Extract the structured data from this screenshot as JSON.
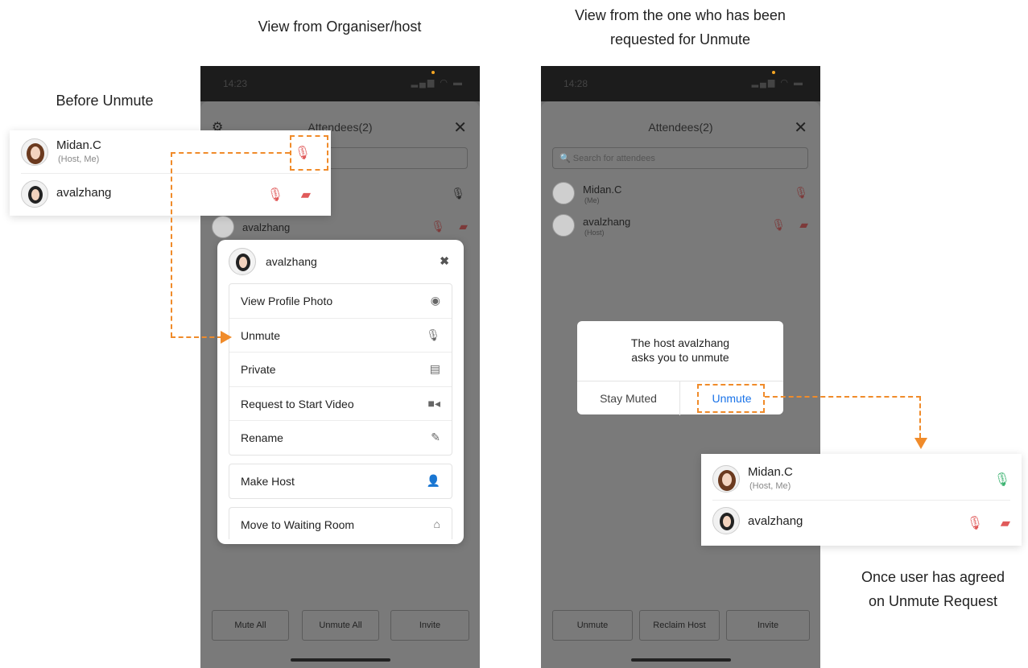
{
  "captions": {
    "organiser": "View from Organiser/host",
    "requested_line1": "View from the one who has been",
    "requested_line2": "requested for Unmute",
    "before": "Before Unmute",
    "after_line1": "Once user has agreed",
    "after_line2": "on Unmute Request"
  },
  "phone_left": {
    "time": "14:23",
    "title": "Attendees(2)",
    "rows": [
      {
        "name": "avalzhang"
      }
    ],
    "bottom_buttons": [
      "Mute All",
      "Unmute All",
      "Invite"
    ]
  },
  "phone_right": {
    "time": "14:28",
    "title": "Attendees(2)",
    "search_placeholder": "Search for attendees",
    "rows": [
      {
        "name": "Midan.C",
        "sub": "(Me)"
      },
      {
        "name": "avalzhang",
        "sub": "(Host)"
      }
    ],
    "bottom_buttons": [
      "Unmute",
      "Reclaim Host",
      "Invite"
    ]
  },
  "before_card": {
    "rows": [
      {
        "name": "Midan.C",
        "sub": "(Host, Me)"
      },
      {
        "name": "avalzhang",
        "sub": ""
      }
    ]
  },
  "action_sheet": {
    "name": "avalzhang",
    "group1": [
      {
        "label": "View Profile Photo",
        "icon": "profile-icon"
      },
      {
        "label": "Unmute",
        "icon": "mic-icon"
      },
      {
        "label": "Private",
        "icon": "chat-icon"
      },
      {
        "label": "Request to Start Video",
        "icon": "video-icon"
      },
      {
        "label": "Rename",
        "icon": "pencil-icon"
      }
    ],
    "group2": [
      {
        "label": "Make Host",
        "icon": "person-icon"
      }
    ],
    "group3": [
      {
        "label": "Move to Waiting Room",
        "icon": "waiting-room-icon"
      }
    ]
  },
  "dialog": {
    "line1": "The host avalzhang",
    "line2": "asks you to unmute",
    "cancel": "Stay Muted",
    "confirm": "Unmute"
  },
  "after_card": {
    "rows": [
      {
        "name": "Midan.C",
        "sub": "(Host, Me)"
      },
      {
        "name": "avalzhang",
        "sub": ""
      }
    ]
  },
  "colors": {
    "accent_orange": "#f08b2a",
    "link_blue": "#1a73e8",
    "mic_green": "#3cb371",
    "muted_red": "#e05a5a"
  }
}
